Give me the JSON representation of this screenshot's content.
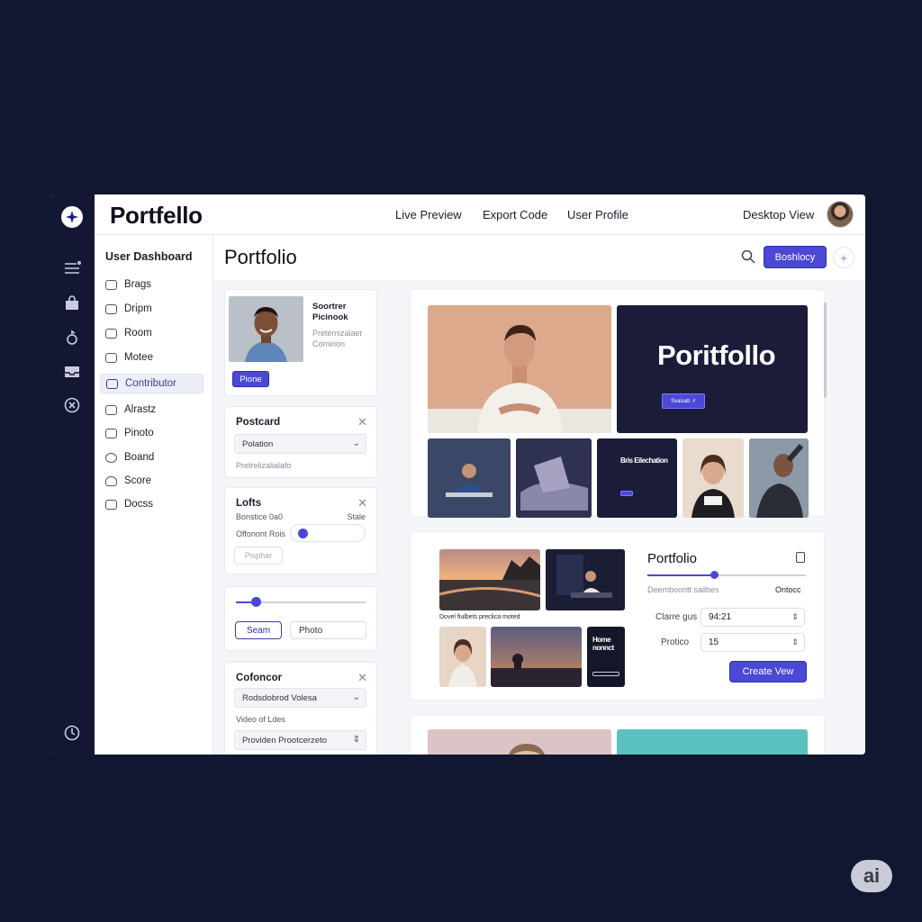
{
  "topbar": {
    "brand": "Portfello",
    "links": [
      "Live Preview",
      "Export Code",
      "User Profile"
    ],
    "view_label": "Desktop View"
  },
  "sidebar": {
    "heading": "User Dashboard",
    "items": [
      {
        "label": "Brags",
        "icon": "card-icon"
      },
      {
        "label": "Dripm",
        "icon": "chart-icon"
      },
      {
        "label": "Room",
        "icon": "grid-icon"
      },
      {
        "label": "Motee",
        "icon": "mail-icon"
      },
      {
        "label": "Contributor",
        "icon": "user-card-icon",
        "active": true
      },
      {
        "label": "Alrastz",
        "icon": "layers-icon"
      },
      {
        "label": "Pinoto",
        "icon": "image-icon"
      },
      {
        "label": "Boand",
        "icon": "circle-icon"
      },
      {
        "label": "Score",
        "icon": "person-icon"
      },
      {
        "label": "Docss",
        "icon": "doc-icon"
      }
    ]
  },
  "content": {
    "title": "Portfolio",
    "primary_button": "Boshlocy",
    "plus_label": "+"
  },
  "profile_card": {
    "name": "Soortrer Picinook",
    "role": "Pretemizalaer Comirion",
    "button": "Pione"
  },
  "postcard_card": {
    "title": "Postcard",
    "select_value": "Polation",
    "hint": "Pretrelizalialafo"
  },
  "lofts_card": {
    "title": "Lofts",
    "label_left": "Bonstice 0a0",
    "label_right": "Stale",
    "toggle_label": "Offonont Rois",
    "ghost_button": "Pisphar"
  },
  "slider_card": {
    "slider_value": 0.15,
    "button": "Seam",
    "input_value": "Photo"
  },
  "cofoncor_card": {
    "title": "Cofoncor",
    "select_value": "Rodsdobrod Volesa",
    "label": "Video of Ldes",
    "select2_value": "Providen Prootcerzeto"
  },
  "preview1": {
    "hero_title": "Poritfollo",
    "hero_button": "Sxaisati  ↗",
    "thumb_title": "Bris Eilechation"
  },
  "preview2": {
    "caption": "Dovel fiulbets preclica moted",
    "thumb_title": "Home nonnct",
    "title": "Portfolio",
    "slider_value": 0.42,
    "slider_left_label": "Deemboontt sailbes",
    "slider_right_label": "Ontocc",
    "field1_label": "Clarre gus",
    "field1_value": "94:21",
    "field2_label": "Protico",
    "field2_value": "15",
    "button": "Create Vew"
  },
  "badge": "ai",
  "colors": {
    "accent": "#4b48d6",
    "rail": "#131733",
    "background": "#111631"
  }
}
